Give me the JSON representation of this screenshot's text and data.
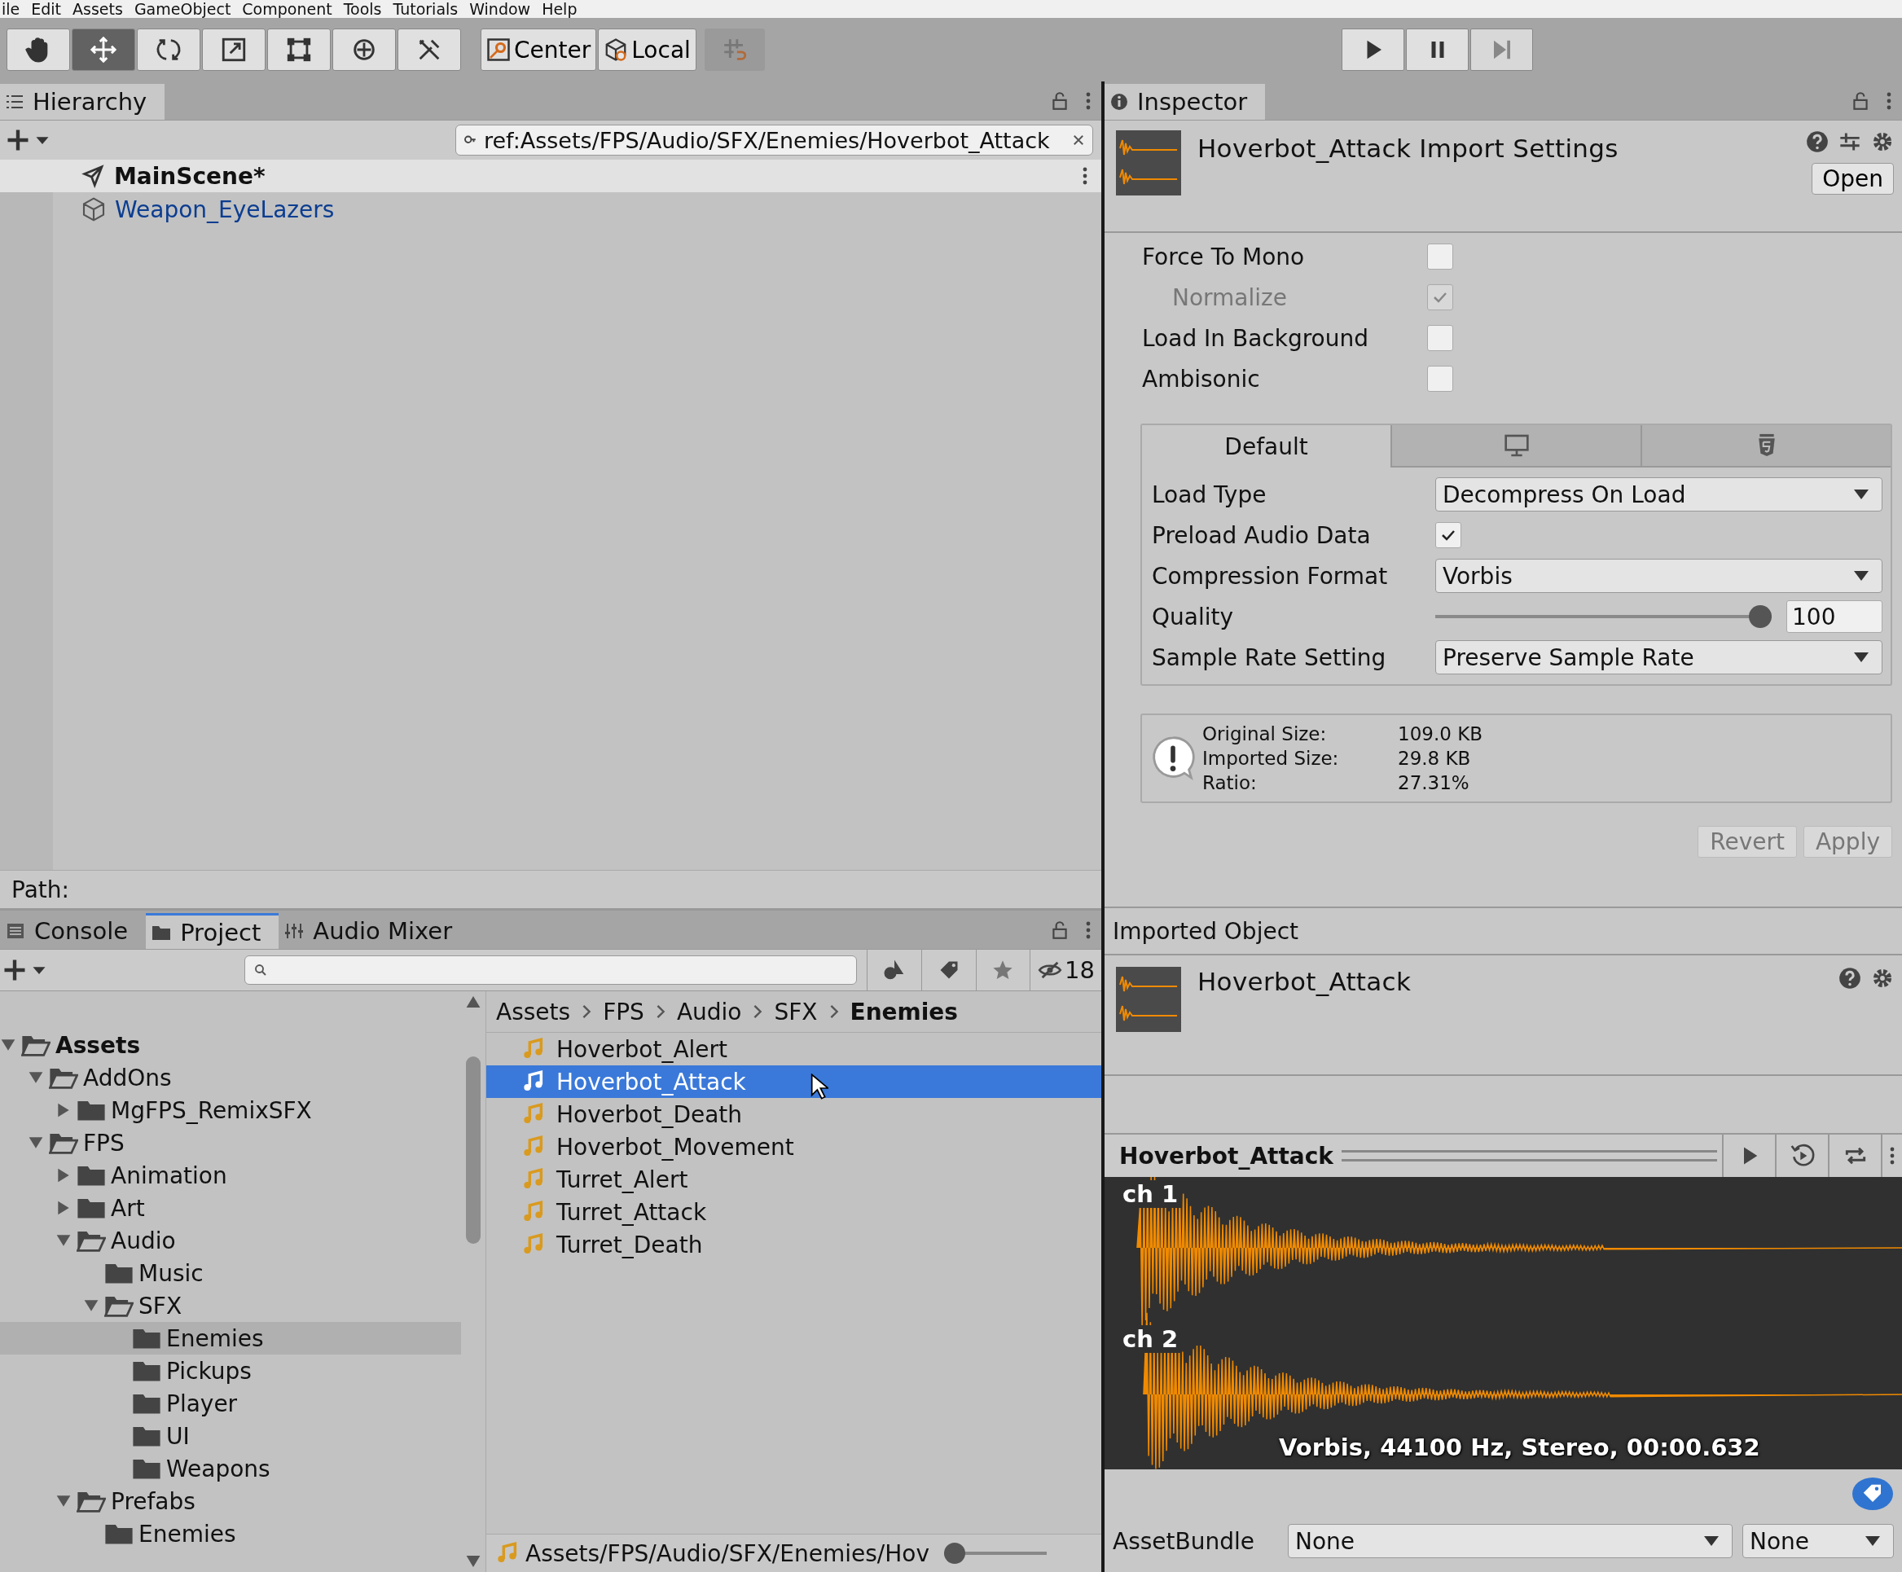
{
  "menu_bar": [
    "ile",
    "Edit",
    "Assets",
    "GameObject",
    "Component",
    "Tools",
    "Tutorials",
    "Window",
    "Help"
  ],
  "toolbar": {
    "tools": [
      {
        "kind": "hand",
        "selected": false
      },
      {
        "kind": "move",
        "selected": true
      },
      {
        "kind": "rotate",
        "selected": false
      },
      {
        "kind": "scale",
        "selected": false
      },
      {
        "kind": "rect",
        "selected": false
      },
      {
        "kind": "transform",
        "selected": false
      },
      {
        "kind": "custom",
        "selected": false
      }
    ],
    "pivot": [
      {
        "kind": "center",
        "label": "Center"
      },
      {
        "kind": "local",
        "label": "Local"
      }
    ],
    "playback": [
      {
        "kind": "play",
        "disabled": false
      },
      {
        "kind": "pause",
        "disabled": false
      },
      {
        "kind": "step",
        "disabled": true
      }
    ]
  },
  "hierarchy": {
    "tab": "Hierarchy",
    "search": "ref:Assets/FPS/Audio/SFX/Enemies/Hoverbot_Attack",
    "scene": "MainScene*",
    "items": [
      {
        "label": "Weapon_EyeLazers"
      }
    ],
    "path_label": "Path:"
  },
  "project": {
    "tabs": [
      {
        "kind": "console",
        "label": "Console",
        "selected": false
      },
      {
        "kind": "project",
        "label": "Project",
        "selected": true
      },
      {
        "kind": "mixer",
        "label": "Audio Mixer",
        "selected": false
      }
    ],
    "hidden_count": "18",
    "tree": [
      {
        "label": "Assets",
        "expanded": true,
        "selected": false,
        "children": [
          {
            "label": "AddOns",
            "expanded": true,
            "selected": false,
            "children": [
              {
                "label": "MgFPS_RemixSFX",
                "expanded": false,
                "selected": false
              }
            ]
          },
          {
            "label": "FPS",
            "expanded": true,
            "selected": false,
            "children": [
              {
                "label": "Animation",
                "expanded": false,
                "selected": false
              },
              {
                "label": "Art",
                "expanded": false,
                "selected": false
              },
              {
                "label": "Audio",
                "expanded": true,
                "selected": false,
                "children": [
                  {
                    "label": "Music",
                    "selected": false
                  },
                  {
                    "label": "SFX",
                    "expanded": true,
                    "selected": false,
                    "children": [
                      {
                        "label": "Enemies",
                        "selected": true
                      },
                      {
                        "label": "Pickups",
                        "selected": false
                      },
                      {
                        "label": "Player",
                        "selected": false
                      },
                      {
                        "label": "UI",
                        "selected": false
                      },
                      {
                        "label": "Weapons",
                        "selected": false
                      }
                    ]
                  }
                ]
              },
              {
                "label": "Prefabs",
                "expanded": true,
                "selected": false,
                "children": [
                  {
                    "label": "Enemies",
                    "selected": false
                  }
                ]
              }
            ]
          }
        ]
      }
    ],
    "breadcrumb": [
      "Assets",
      "FPS",
      "Audio",
      "SFX",
      "Enemies"
    ],
    "files": [
      {
        "label": "Hoverbot_Alert",
        "selected": false
      },
      {
        "label": "Hoverbot_Attack",
        "selected": true
      },
      {
        "label": "Hoverbot_Death",
        "selected": false
      },
      {
        "label": "Hoverbot_Movement",
        "selected": false
      },
      {
        "label": "Turret_Alert",
        "selected": false
      },
      {
        "label": "Turret_Attack",
        "selected": false
      },
      {
        "label": "Turret_Death",
        "selected": false
      }
    ],
    "status_path": "Assets/FPS/Audio/SFX/Enemies/Hov",
    "icon_size": {
      "level": 0
    }
  },
  "inspector": {
    "tab": "Inspector",
    "title": "Hoverbot_Attack Import Settings",
    "open_button": "Open",
    "options": [
      {
        "label": "Force To Mono",
        "checked": false,
        "disabled": false,
        "indent": false
      },
      {
        "label": "Normalize",
        "checked": true,
        "disabled": true,
        "indent": true
      },
      {
        "label": "Load In Background",
        "checked": false,
        "disabled": false,
        "indent": false
      },
      {
        "label": "Ambisonic",
        "checked": false,
        "disabled": false,
        "indent": false
      }
    ],
    "platform_tabs": [
      {
        "kind": "default",
        "label": "Default",
        "selected": true
      },
      {
        "kind": "desktop",
        "selected": false
      },
      {
        "kind": "html5",
        "selected": false
      }
    ],
    "fields": [
      {
        "kind": "dropdown",
        "label": "Load Type",
        "value": "Decompress On Load"
      },
      {
        "kind": "checkbox",
        "label": "Preload Audio Data",
        "checked": true
      },
      {
        "kind": "dropdown",
        "label": "Compression Format",
        "value": "Vorbis"
      },
      {
        "kind": "slider",
        "label": "Quality",
        "level": 1,
        "value": "100"
      },
      {
        "kind": "dropdown",
        "label": "Sample Rate Setting",
        "value": "Preserve Sample Rate"
      }
    ],
    "info": [
      {
        "label": "Original Size:",
        "value": "109.0 KB"
      },
      {
        "label": "Imported Size:",
        "value": "29.8 KB"
      },
      {
        "label": "Ratio:",
        "value": "27.31%"
      }
    ],
    "buttons": [
      {
        "label": "Revert",
        "disabled": true
      },
      {
        "label": "Apply",
        "disabled": true
      }
    ],
    "imported_heading": "Imported Object",
    "imported_name": "Hoverbot_Attack",
    "preview": {
      "title": "Hoverbot_Attack",
      "channels": [
        "ch 1",
        "ch 2"
      ],
      "info": "Vorbis, 44100 Hz, Stereo, 00:00.632"
    },
    "asset_bundle": {
      "label": "AssetBundle",
      "values": [
        "None",
        "None"
      ]
    }
  }
}
